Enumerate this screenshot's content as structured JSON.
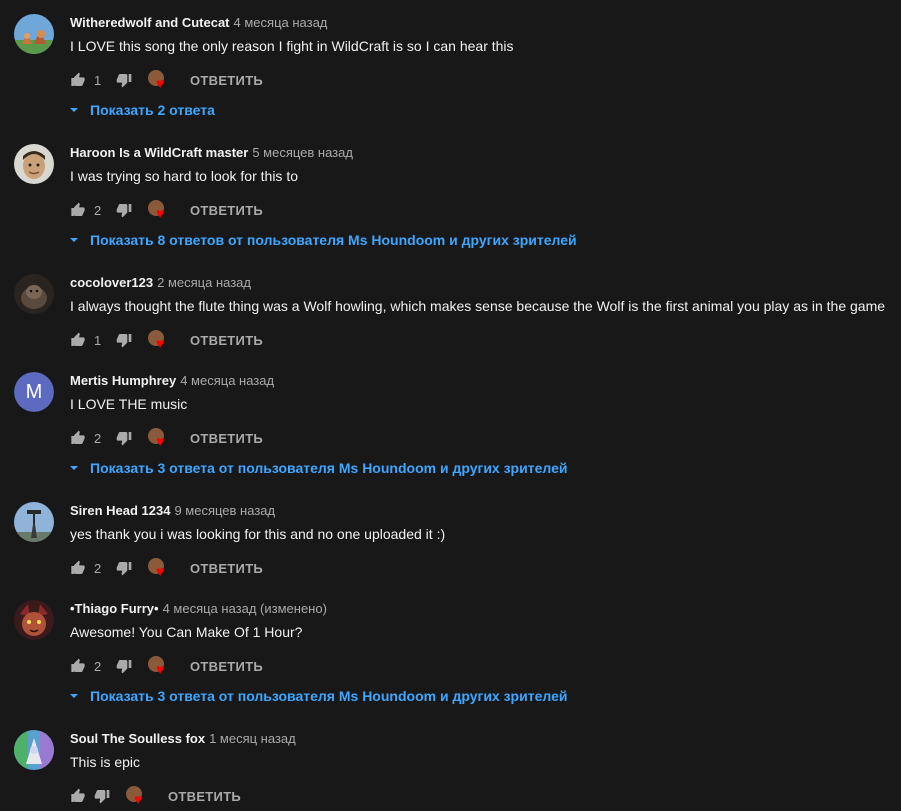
{
  "colors": {
    "background": "#181818",
    "text": "#f1f1f1",
    "secondary": "#aaaaaa",
    "link": "#3ea6ff",
    "heart": "#ff0000"
  },
  "reply_label": "ОТВЕТИТЬ",
  "comments": [
    {
      "author": "Witheredwolf and Cutecat",
      "time": "4 месяца назад",
      "text": "I LOVE this song the only reason I fight in WildCraft is so I can hear this",
      "likes": "1",
      "replies": "Показать 2 ответа",
      "avatar_icon": "wolf-cat-avatar"
    },
    {
      "author": "Haroon Is a WildCraft master",
      "time": "5 месяцев назад",
      "text": "I was trying so hard to look for this to",
      "likes": "2",
      "replies": "Показать 8 ответов от пользователя Ms Houndoom и других зрителей",
      "avatar_icon": "face-avatar"
    },
    {
      "author": "cocolover123",
      "time": "2 месяца назад",
      "text": "I always thought the flute thing was a Wolf howling, which makes sense because the Wolf is the first animal you play as in the game",
      "likes": "1",
      "replies": "",
      "avatar_icon": "dark-animal-avatar"
    },
    {
      "author": "Mertis Humphrey",
      "time": "4 месяца назад",
      "text": "I LOVE THE music",
      "likes": "2",
      "replies": "Показать 3 ответа от пользователя Ms Houndoom и других зрителей",
      "avatar_icon": "letter-avatar",
      "avatar_letter": "M",
      "avatar_color": "#5c6bc0"
    },
    {
      "author": "Siren Head 1234",
      "time": "9 месяцев назад",
      "text": "yes thank you i was looking for this and no one uploaded it :)",
      "likes": "2",
      "replies": "",
      "avatar_icon": "siren-head-avatar"
    },
    {
      "author": "•Thiago Furry•",
      "time": "4 месяца назад (изменено)",
      "text": "Awesome! You Can Make Of 1 Hour?",
      "likes": "2",
      "replies": "Показать 3 ответа от пользователя Ms Houndoom и других зрителей",
      "avatar_icon": "furry-avatar"
    },
    {
      "author": "Soul The Soulless fox",
      "time": "1 месяц назад",
      "text": "This is epic",
      "likes": "",
      "replies": "",
      "avatar_icon": "fox-avatar"
    }
  ]
}
